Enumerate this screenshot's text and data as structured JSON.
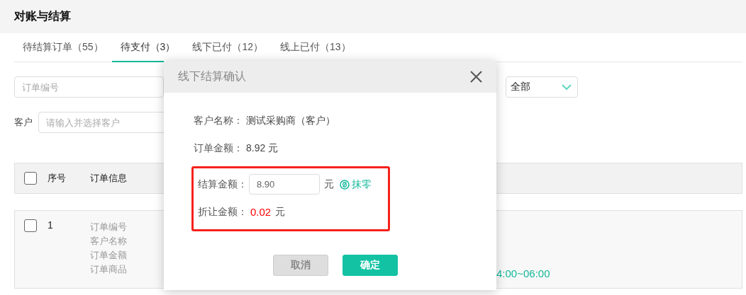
{
  "page": {
    "title": "对账与结算"
  },
  "tabs": [
    {
      "label": "待结算订单（55）",
      "selected": false
    },
    {
      "label": "待支付（3）",
      "selected": true
    },
    {
      "label": "线下已付（12）",
      "selected": false
    },
    {
      "label": "线上已付（13）",
      "selected": false
    }
  ],
  "filters": {
    "order_no": {
      "placeholder": "订单编号"
    },
    "status_select": {
      "value": "全部"
    },
    "customer": {
      "label": "客户",
      "placeholder": "请输入并选择客户"
    }
  },
  "table": {
    "select_all": {
      "checked": false
    },
    "columns": [
      "序号",
      "订单信息"
    ],
    "rows": [
      {
        "checked": false,
        "index": "1",
        "info_lines": [
          "订单编号",
          "客户名称",
          "订单金额",
          "订单商品"
        ],
        "time": "4:00~06:00"
      }
    ]
  },
  "dialog": {
    "title": "线下结算确认",
    "fields": [
      {
        "kind": "text",
        "label": "客户名称：",
        "value": "测试采购商（客户）",
        "highlighted": false
      },
      {
        "kind": "text",
        "label": "订单金额：",
        "value": "8.92 元",
        "highlighted": false
      },
      {
        "kind": "input",
        "label": "结算金额：",
        "value": "8.90",
        "unit": "元",
        "action": "抹零",
        "highlighted": true
      },
      {
        "kind": "discount",
        "label": "折让金额：",
        "value": "0.02",
        "unit": "元",
        "highlighted": true
      }
    ],
    "buttons": [
      {
        "label": "取消",
        "kind": "secondary"
      },
      {
        "label": "确定",
        "kind": "primary"
      }
    ]
  }
}
